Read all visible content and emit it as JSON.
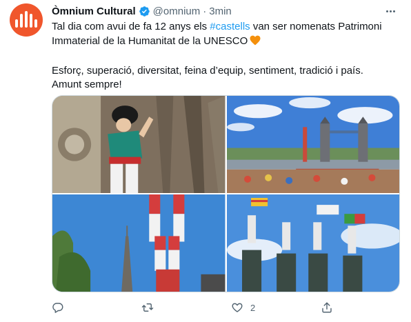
{
  "tweet": {
    "author_name": "Òmnium Cultural",
    "handle": "@omnium",
    "separator": "·",
    "time": "3min",
    "text_before": "Tal dia com avui de fa 12 anys els ",
    "hashtag": "#castells",
    "text_after": " van ser nomenats Patrimoni Immaterial de la Humanitat de la UNESCO",
    "line2": "Esforç, superació, diversitat, feina d’equip, sentiment, tradició i país.",
    "line3": "Amunt sempre!"
  },
  "actions": {
    "reply_count": "",
    "retweet_count": "",
    "like_count": "2",
    "share_count": ""
  },
  "colors": {
    "accent": "#1d9bf0",
    "brand": "#f0562c",
    "heart": "#f4900c",
    "muted": "#536471"
  },
  "icons": [
    "verified-badge-icon",
    "more-options-icon",
    "orange-heart-icon",
    "reply-icon",
    "retweet-icon",
    "like-icon",
    "share-icon"
  ]
}
